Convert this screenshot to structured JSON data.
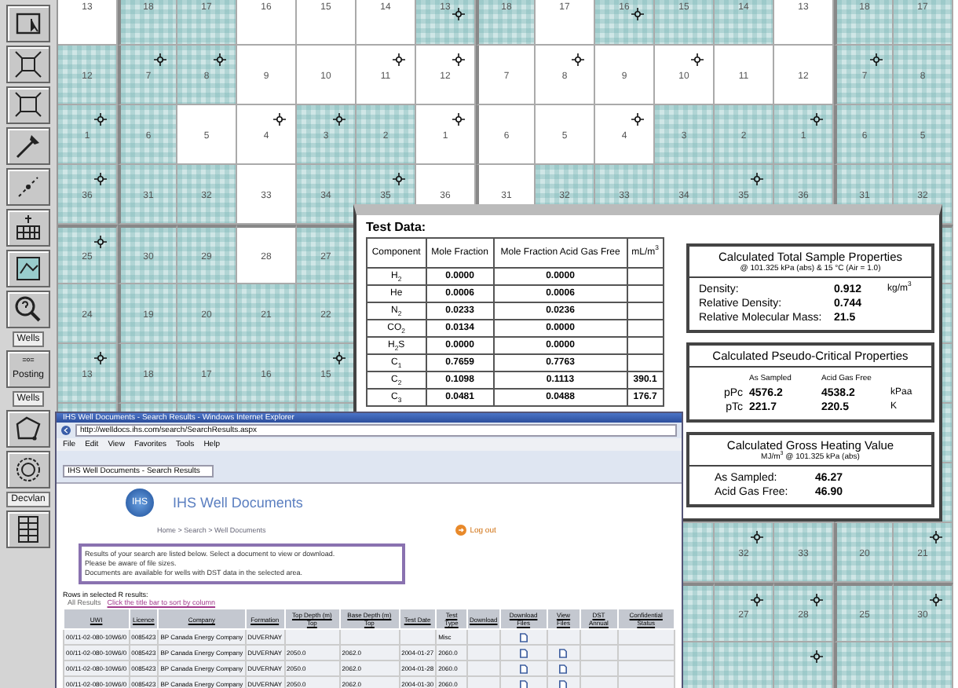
{
  "toolbar": [
    {
      "kind": "tool"
    },
    {
      "kind": "tool"
    },
    {
      "kind": "tool"
    },
    {
      "kind": "tool"
    },
    {
      "kind": "tool"
    },
    {
      "kind": "tool"
    },
    {
      "kind": "tool"
    },
    {
      "kind": "tool"
    },
    {
      "kind": "label",
      "label": "Wells"
    },
    {
      "kind": "tool",
      "label": "Posting"
    },
    {
      "kind": "label",
      "label": "Wells"
    },
    {
      "kind": "tool"
    },
    {
      "kind": "tool"
    },
    {
      "kind": "label",
      "label": "Decvlan"
    },
    {
      "kind": "tool"
    }
  ],
  "map": {
    "rows": [
      {
        "cells": [
          {
            "label": "13",
            "shaded": false,
            "well": false
          },
          {
            "label": "18",
            "shaded": true,
            "well": false
          },
          {
            "label": "17",
            "shaded": true,
            "well": false
          },
          {
            "label": "16",
            "shaded": false,
            "well": false
          },
          {
            "label": "15",
            "shaded": false,
            "well": false
          },
          {
            "label": "14",
            "shaded": false,
            "well": false
          },
          {
            "label": "13",
            "shaded": true,
            "well": true
          },
          {
            "label": "18",
            "shaded": true,
            "well": false
          },
          {
            "label": "17",
            "shaded": false,
            "well": false
          },
          {
            "label": "16",
            "shaded": true,
            "well": true
          },
          {
            "label": "15",
            "shaded": true,
            "well": false
          },
          {
            "label": "14",
            "shaded": true,
            "well": false
          },
          {
            "label": "13",
            "shaded": false,
            "well": false
          },
          {
            "label": "18",
            "shaded": true,
            "well": false
          },
          {
            "label": "17",
            "shaded": true,
            "well": false
          }
        ]
      },
      {
        "cells": [
          {
            "label": "12",
            "shaded": true,
            "well": false
          },
          {
            "label": "7",
            "shaded": true,
            "well": true
          },
          {
            "label": "8",
            "shaded": true,
            "well": true
          },
          {
            "label": "9",
            "shaded": false,
            "well": false
          },
          {
            "label": "10",
            "shaded": false,
            "well": false
          },
          {
            "label": "11",
            "shaded": false,
            "well": true
          },
          {
            "label": "12",
            "shaded": false,
            "well": true
          },
          {
            "label": "7",
            "shaded": false,
            "well": false
          },
          {
            "label": "8",
            "shaded": false,
            "well": true
          },
          {
            "label": "9",
            "shaded": false,
            "well": false
          },
          {
            "label": "10",
            "shaded": false,
            "well": true
          },
          {
            "label": "11",
            "shaded": false,
            "well": false
          },
          {
            "label": "12",
            "shaded": false,
            "well": false
          },
          {
            "label": "7",
            "shaded": true,
            "well": true
          },
          {
            "label": "8",
            "shaded": true,
            "well": false
          }
        ]
      },
      {
        "cells": [
          {
            "label": "1",
            "shaded": true,
            "well": true
          },
          {
            "label": "6",
            "shaded": true,
            "well": false
          },
          {
            "label": "5",
            "shaded": false,
            "well": false
          },
          {
            "label": "4",
            "shaded": false,
            "well": true
          },
          {
            "label": "3",
            "shaded": true,
            "well": true
          },
          {
            "label": "2",
            "shaded": true,
            "well": false
          },
          {
            "label": "1",
            "shaded": false,
            "well": true
          },
          {
            "label": "6",
            "shaded": false,
            "well": false
          },
          {
            "label": "5",
            "shaded": false,
            "well": false
          },
          {
            "label": "4",
            "shaded": false,
            "well": true
          },
          {
            "label": "3",
            "shaded": true,
            "well": false
          },
          {
            "label": "2",
            "shaded": true,
            "well": false
          },
          {
            "label": "1",
            "shaded": true,
            "well": true
          },
          {
            "label": "6",
            "shaded": true,
            "well": false
          },
          {
            "label": "5",
            "shaded": true,
            "well": false
          }
        ]
      },
      {
        "cells": [
          {
            "label": "36",
            "shaded": true,
            "well": true
          },
          {
            "label": "31",
            "shaded": true,
            "well": false
          },
          {
            "label": "32",
            "shaded": true,
            "well": false
          },
          {
            "label": "33",
            "shaded": false,
            "well": false
          },
          {
            "label": "34",
            "shaded": true,
            "well": false
          },
          {
            "label": "35",
            "shaded": true,
            "well": true
          },
          {
            "label": "36",
            "shaded": false,
            "well": false
          },
          {
            "label": "31",
            "shaded": false,
            "well": false
          },
          {
            "label": "32",
            "shaded": true,
            "well": false
          },
          {
            "label": "33",
            "shaded": true,
            "well": false
          },
          {
            "label": "34",
            "shaded": true,
            "well": false
          },
          {
            "label": "35",
            "shaded": true,
            "well": true
          },
          {
            "label": "36",
            "shaded": true,
            "well": false
          },
          {
            "label": "31",
            "shaded": true,
            "well": false
          },
          {
            "label": "32",
            "shaded": true,
            "well": false
          }
        ]
      },
      {
        "cells": [
          {
            "label": "25",
            "shaded": true,
            "well": true
          },
          {
            "label": "30",
            "shaded": true,
            "well": false
          },
          {
            "label": "29",
            "shaded": true,
            "well": false
          },
          {
            "label": "28",
            "shaded": false,
            "well": false
          },
          {
            "label": "27",
            "shaded": true,
            "well": false
          },
          null,
          null,
          null,
          null,
          null,
          null,
          null,
          null,
          null,
          {
            "shaded": true
          }
        ]
      },
      {
        "cells": [
          {
            "label": "24",
            "shaded": true,
            "well": false
          },
          {
            "label": "19",
            "shaded": true,
            "well": false
          },
          {
            "label": "20",
            "shaded": true,
            "well": false
          },
          {
            "label": "21",
            "shaded": true,
            "well": false
          },
          {
            "label": "22",
            "shaded": true,
            "well": false
          },
          null,
          null,
          null,
          null,
          null,
          null,
          null,
          null,
          null,
          {
            "shaded": true
          }
        ]
      },
      {
        "cells": [
          {
            "label": "13",
            "shaded": true,
            "well": true
          },
          {
            "label": "18",
            "shaded": true,
            "well": false
          },
          {
            "label": "17",
            "shaded": true,
            "well": false
          },
          {
            "label": "16",
            "shaded": true,
            "well": false
          },
          {
            "label": "15",
            "shaded": true,
            "well": true
          },
          null,
          null,
          null,
          null,
          null,
          null,
          null,
          null,
          null,
          {
            "shaded": true
          }
        ]
      },
      {
        "cells": [
          null,
          null,
          null,
          null,
          null,
          null,
          null,
          null,
          null,
          null,
          null,
          null,
          null,
          null,
          {
            "shaded": true
          }
        ]
      },
      {
        "cells": [
          null,
          null,
          null,
          null,
          null,
          null,
          null,
          null,
          null,
          null,
          null,
          null,
          null,
          null,
          {
            "shaded": true
          }
        ]
      },
      {
        "cells": [
          null,
          null,
          null,
          null,
          null,
          null,
          null,
          null,
          null,
          null,
          {
            "shaded": true,
            "well": false
          },
          {
            "label": "32",
            "shaded": true,
            "well": true
          },
          {
            "label": "33",
            "shaded": true,
            "well": false
          },
          {
            "label": "20",
            "shaded": true,
            "well": false
          },
          {
            "label": "21",
            "shaded": true,
            "well": true
          }
        ]
      },
      {
        "cells": [
          null,
          null,
          null,
          null,
          null,
          null,
          null,
          null,
          null,
          null,
          {
            "shaded": true,
            "well": false
          },
          {
            "label": "27",
            "shaded": true,
            "well": true
          },
          {
            "label": "28",
            "shaded": true,
            "well": true
          },
          {
            "label": "25",
            "shaded": true,
            "well": false
          },
          {
            "label": "30",
            "shaded": true,
            "well": true
          }
        ]
      },
      {
        "cells": [
          null,
          null,
          null,
          null,
          null,
          null,
          null,
          null,
          null,
          null,
          {
            "shaded": true,
            "well": false
          },
          {
            "shaded": true,
            "well": false
          },
          {
            "shaded": true,
            "well": true
          },
          {
            "shaded": true,
            "well": false
          },
          {
            "shaded": true,
            "well": false
          }
        ]
      }
    ]
  },
  "test_data": {
    "title": "Test Data:",
    "columns": [
      "Component",
      "Mole Fraction",
      "Mole Fraction Acid Gas Free",
      "mL/m$^{3}$"
    ],
    "rows": [
      [
        "H$_{2}$",
        "0.0000",
        "0.0000",
        ""
      ],
      [
        "He",
        "0.0006",
        "0.0006",
        ""
      ],
      [
        "N$_{2}$",
        "0.0233",
        "0.0236",
        ""
      ],
      [
        "CO$_{2}$",
        "0.0134",
        "0.0000",
        ""
      ],
      [
        "H$_{2}$S",
        "0.0000",
        "0.0000",
        ""
      ],
      [
        "C$_{1}$",
        "0.7659",
        "0.7763",
        ""
      ],
      [
        "C$_{2}$",
        "0.1098",
        "0.1113",
        "390.1"
      ],
      [
        "C$_{3}$",
        "0.0481",
        "0.0488",
        "176.7"
      ]
    ],
    "total_properties": {
      "title": "Calculated Total Sample Properties",
      "subtitle": "@ 101.325 kPa (abs) & 15 °C (Air = 1.0)",
      "items": [
        {
          "label": "Density:",
          "value": "0.912",
          "unit": "kg/m$^{3}$"
        },
        {
          "label": "Relative Density:",
          "value": "0.744"
        },
        {
          "label": "Relative Molecular Mass:",
          "value": "21.5"
        }
      ]
    },
    "pseudo_critical": {
      "title": "Calculated Pseudo-Critical Properties",
      "columns": [
        "As Sampled",
        "Acid Gas Free"
      ],
      "rows": [
        {
          "label": "pPc",
          "values": [
            "4576.2",
            "4538.2"
          ],
          "unit": "kPaa"
        },
        {
          "label": "pTc",
          "values": [
            "221.7",
            "220.5"
          ],
          "unit": "K"
        }
      ]
    },
    "heating_value": {
      "title": "Calculated Gross Heating Value",
      "subtitle": "MJ/m$^{3}$ @ 101.325 kPa (abs)",
      "items": [
        {
          "label": "As Sampled:",
          "value": "46.27"
        },
        {
          "label": "Acid Gas Free:",
          "value": "46.90"
        }
      ]
    }
  },
  "browser": {
    "title": "IHS Well Documents - Search Results - Windows Internet Explorer",
    "address": "http://welldocs.ihs.com/search/SearchResults.aspx",
    "menu": [
      "File",
      "Edit",
      "View",
      "Favorites",
      "Tools",
      "Help"
    ],
    "tab": "IHS Well Documents - Search Results",
    "page": {
      "logo": "IHS",
      "heading": "IHS Well Documents",
      "breadcrumb": "Home > Search > Well Documents",
      "logout": "Log out",
      "notice": [
        "Results of your search are listed below. Select a document to view or download.",
        "Please be aware of file sizes.",
        "Documents are available for wells with DST data in the selected area."
      ],
      "results_title": "Rows in selected R results:",
      "results_label": "All Results",
      "results_link": "Click the title bar to sort by column",
      "columns": [
        "UWI",
        "Licence",
        "Company",
        "Formation",
        "Top Depth (m) Top",
        "Base Depth (m) Top",
        "Test Date",
        "Test Type",
        "Download",
        "Download Files",
        "View Files",
        "DST Annual",
        "Confidential Status"
      ],
      "rows": [
        {
          "cells": [
            "00/11-02-080-10W6/0",
            "0085423",
            "BP Canada Energy Company",
            "DUVERNAY",
            "",
            "",
            "",
            "Misc",
            "",
            "",
            "",
            "",
            ""
          ],
          "download": true,
          "view": false
        },
        {
          "cells": [
            "00/11-02-080-10W6/0",
            "0085423",
            "BP Canada Energy Company",
            "DUVERNAY",
            "2050.0",
            "2062.0",
            "2004-01-27",
            "2060.0",
            "",
            "",
            "",
            "",
            ""
          ],
          "download": true,
          "view": true
        },
        {
          "cells": [
            "00/11-02-080-10W6/0",
            "0085423",
            "BP Canada Energy Company",
            "DUVERNAY",
            "2050.0",
            "2062.0",
            "2004-01-28",
            "2060.0",
            "",
            "",
            "",
            "",
            ""
          ],
          "download": true,
          "view": true
        },
        {
          "cells": [
            "00/11-02-080-10W6/0",
            "0085423",
            "BP Canada Energy Company",
            "DUVERNAY",
            "2050.0",
            "2062.0",
            "2004-01-30",
            "2060.0",
            "",
            "",
            "",
            "",
            ""
          ],
          "download": true,
          "view": true
        }
      ]
    }
  }
}
